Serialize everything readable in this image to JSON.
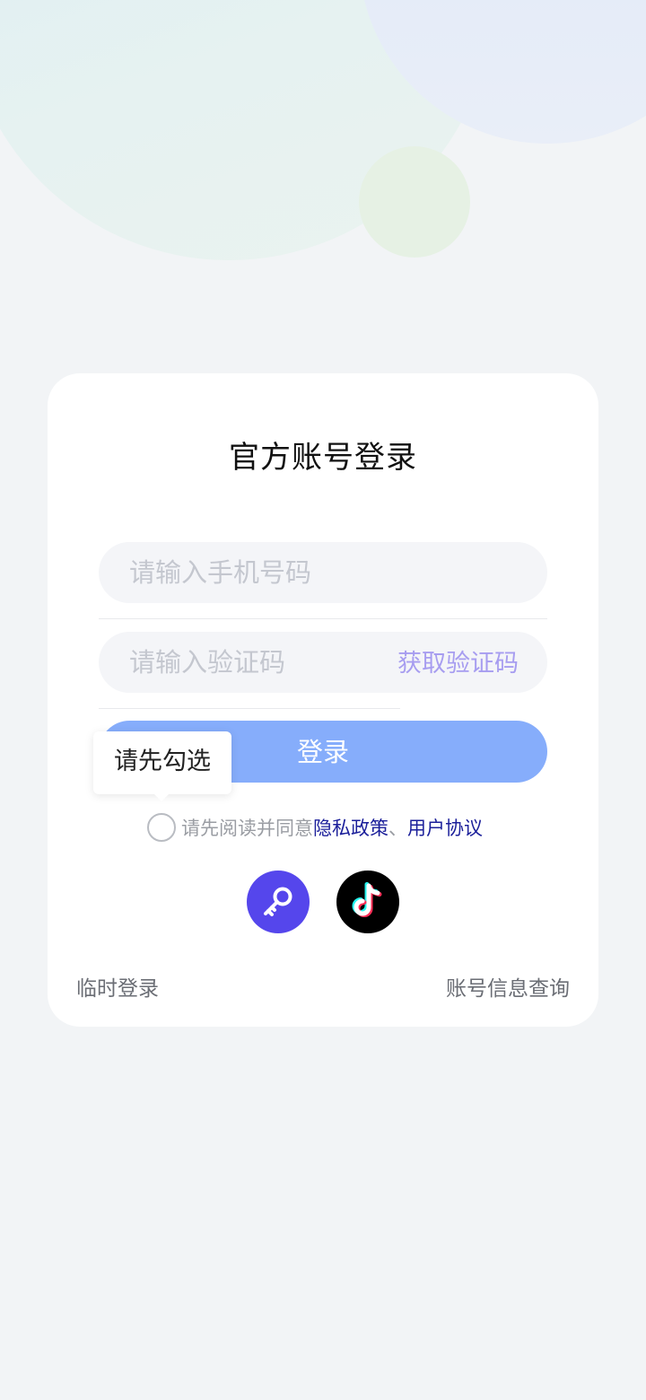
{
  "login": {
    "title": "官方账号登录",
    "phone_placeholder": "请输入手机号码",
    "code_placeholder": "请输入验证码",
    "get_code_label": "获取验证码",
    "login_button_label": "登录",
    "tooltip_text": "请先勾选"
  },
  "agreement": {
    "prefix_text": "请先阅读并同意 ",
    "privacy_link": "隐私政策",
    "separator": "、",
    "user_agreement_link": "用户协议",
    "checked": false
  },
  "social": {
    "items": [
      {
        "icon": "key-icon",
        "color": "#5546ec"
      },
      {
        "icon": "tiktok-icon",
        "color": "#000000"
      }
    ]
  },
  "footer": {
    "temp_login_label": "临时登录",
    "account_query_label": "账号信息查询"
  },
  "colors": {
    "accent": "#86adfb",
    "link": "#1b1f9a",
    "get_code": "#a79df0"
  }
}
